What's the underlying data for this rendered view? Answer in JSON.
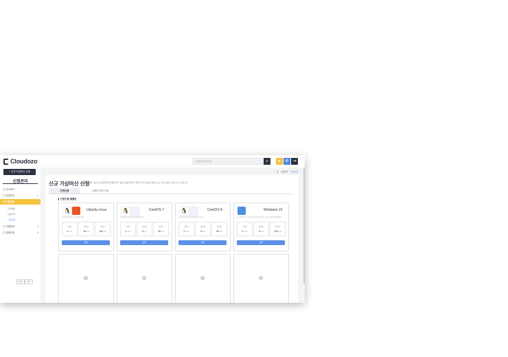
{
  "app": {
    "name": "Cloudozo"
  },
  "topbar": {
    "search_placeholder": "검색어를 입력하세요",
    "search_icon": "search-icon",
    "icons": [
      {
        "name": "user-icon",
        "glyph": "●",
        "color": "#f5c23b"
      },
      {
        "name": "gear-icon",
        "glyph": "⚙",
        "color": "#4a86e8"
      },
      {
        "name": "logout-icon",
        "glyph": "⇥",
        "color": "#2c3340"
      }
    ]
  },
  "sidebar": {
    "new_button": "+ 신규 가상머신 신청",
    "title": "신청관리",
    "menu": [
      {
        "label": "대시보드"
      },
      {
        "label": "운영관리"
      },
      {
        "label": "신청관리",
        "active": true
      },
      {
        "label": "자원관리"
      },
      {
        "label": "결재관리"
      }
    ],
    "submenu": [
      "신청현황",
      "신청이력",
      "신규신청"
    ],
    "lang": [
      "KOR",
      "ENG"
    ]
  },
  "breadcrumb": {
    "home": "홈",
    "parent": "신청관리",
    "current": "신규신청"
  },
  "page": {
    "title": "신규 가상머신 신청",
    "description": "사전에 설정된 가상 머신 템플릿을 활용하거나 필요 자원에 대한 사용자 정의 설정을 통해 신규 가상 머신을 신청 할 수 있습니다.",
    "tabs": [
      "간편신청",
      "사용자 정의 신청"
    ],
    "section_label": "간편신청 템플릿"
  },
  "templates": [
    {
      "name": "Ubuntu Linux",
      "desc": "ubuntu-17.04-server-amd64",
      "icons": [
        "linux-icon",
        "ubuntu-icon"
      ],
      "cpu": "2",
      "ram": "16",
      "disk": "100",
      "cpu_unit": "Core",
      "ram_unit": "GB",
      "disk_unit": "GB",
      "button": "선택"
    },
    {
      "name": "CentOS 7",
      "desc": "CentOS-7-x86_64-DVD-1611",
      "icons": [
        "linux-icon",
        "centos-icon"
      ],
      "cpu": "2",
      "ram": "8",
      "disk": "50",
      "cpu_unit": "Core",
      "ram_unit": "GB",
      "disk_unit": "GB",
      "button": "선택"
    },
    {
      "name": "CentOS 8",
      "desc": "CentOS-8.1.1911-x86_64-dvd1",
      "icons": [
        "linux-icon",
        "centos-icon"
      ],
      "cpu": "2",
      "ram": "8",
      "disk": "50",
      "cpu_unit": "Core",
      "ram_unit": "GB",
      "disk_unit": "GB",
      "button": "선택"
    },
    {
      "name": "Windows 10",
      "desc": "ko_windows_10_business_editions_x64_dvd_9e89d0a2",
      "icons": [
        "windows-icon"
      ],
      "cpu": "4",
      "ram": "8",
      "disk": "100",
      "cpu_unit": "Core",
      "ram_unit": "GB",
      "disk_unit": "GB",
      "button": "선택"
    }
  ],
  "spec_labels": {
    "cpu": "CPU",
    "ram": "RAM",
    "disk": "DISK"
  },
  "add_glyph": "+",
  "colors": {
    "brand_dark": "#2c3340",
    "accent_yellow": "#f5c23b",
    "accent_blue": "#5c8fe6"
  }
}
